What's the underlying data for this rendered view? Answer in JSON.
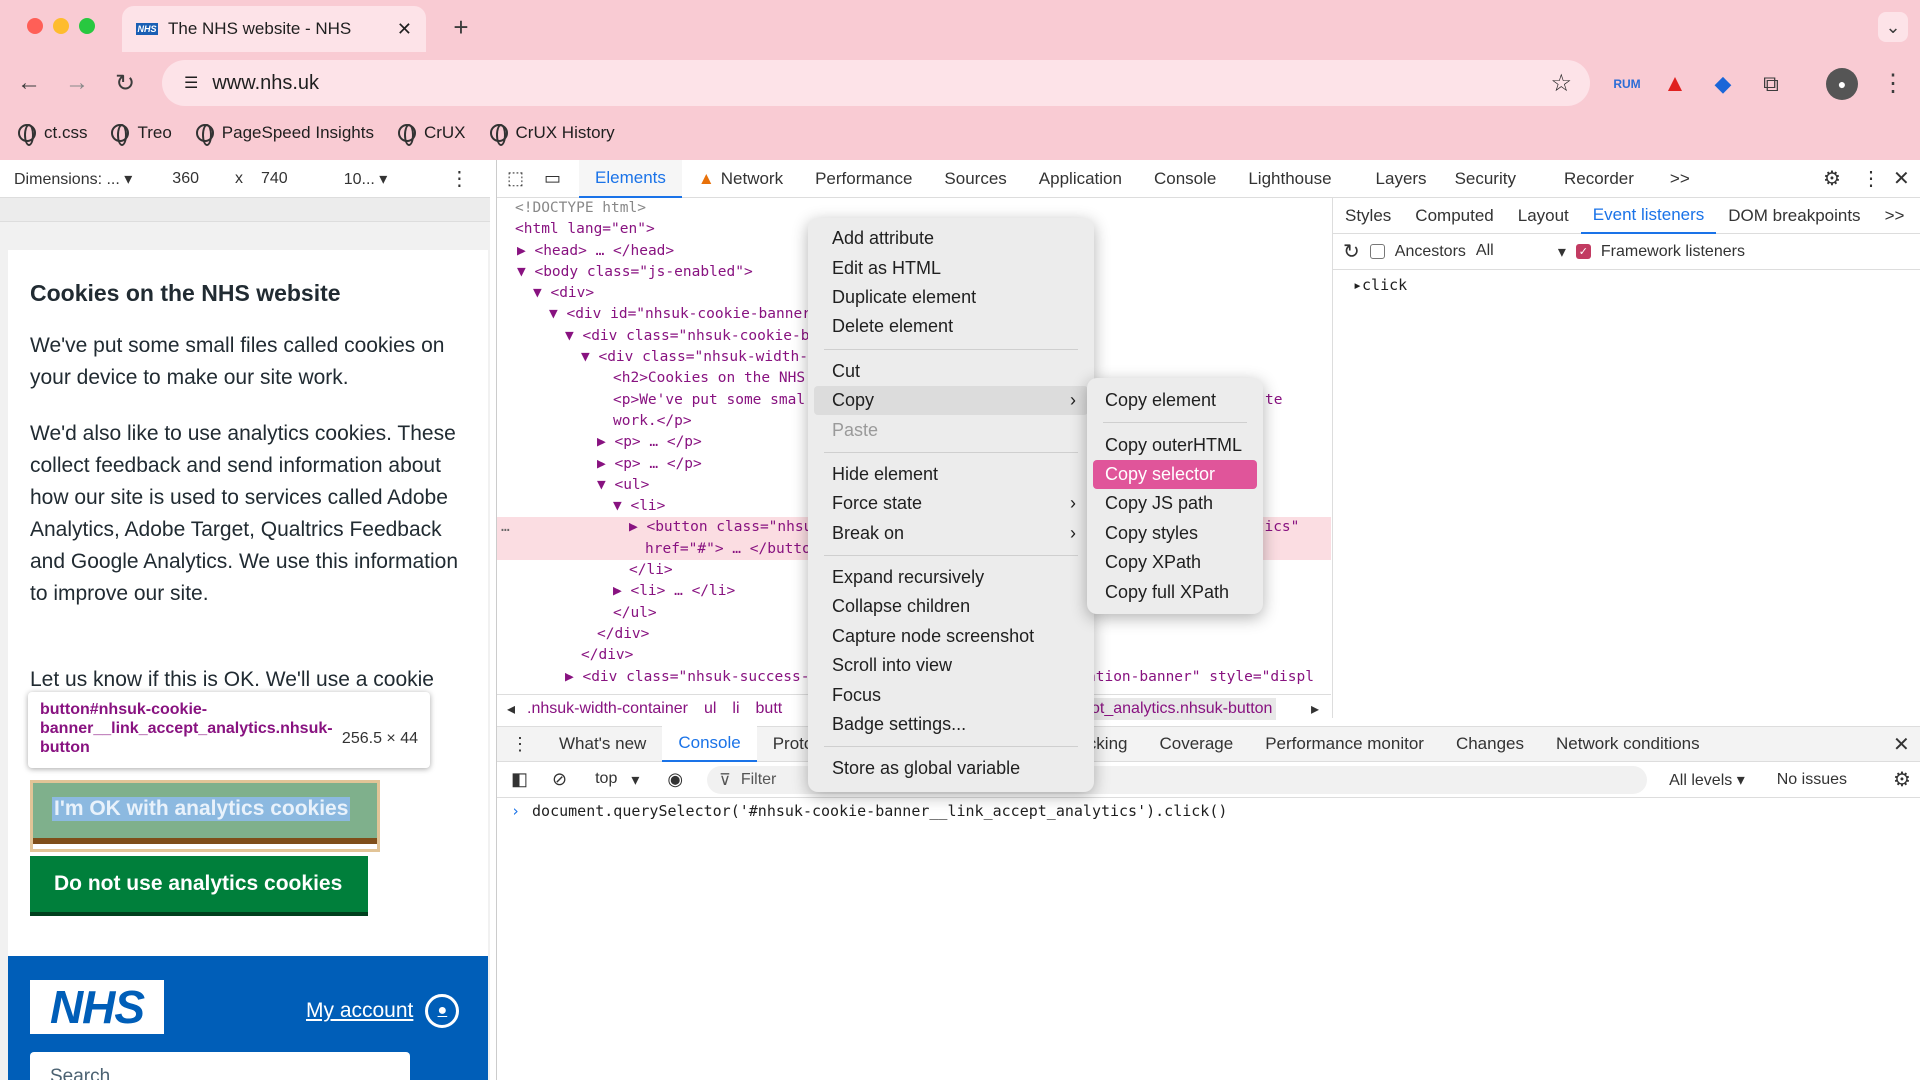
{
  "browser": {
    "tab_title": "The NHS website - NHS",
    "url": "www.nhs.uk",
    "bookmarks": [
      "ct.css",
      "Treo",
      "PageSpeed Insights",
      "CrUX",
      "CrUX History"
    ],
    "extensions": {
      "rum_label": "RUM"
    }
  },
  "device_toolbar": {
    "dimensions_label": "Dimensions: ...",
    "width": "360",
    "times": "x",
    "height": "740",
    "zoom": "10..."
  },
  "page": {
    "heading": "Cookies on the NHS website",
    "para1": "We've put some small files called cookies on your device to make our site work.",
    "para2": "We'd also like to use analytics cookies. These collect feedback and send information about how our site is used to services called Adobe Analytics, Adobe Target, Qualtrics Feedback and Google Analytics. We use this information to improve our site.",
    "para3": "Let us know if this is OK. We'll use a cookie",
    "ok_button": "I'm OK with analytics cookies",
    "no_button": "Do not use analytics cookies",
    "logo": "NHS",
    "my_account": "My account",
    "search_placeholder": "Search"
  },
  "inspect_tooltip": {
    "selector": "button#nhsuk-cookie-banner__link_accept_analytics.nhsuk-button",
    "size": "256.5 × 44"
  },
  "devtools": {
    "tabs": [
      "Elements",
      "Network",
      "Performance",
      "Sources",
      "Application",
      "Console",
      "Lighthouse",
      "Layers",
      "Security",
      "Recorder"
    ],
    "more_tabs": ">>",
    "side_tabs": [
      "Styles",
      "Computed",
      "Layout",
      "Event listeners",
      "DOM breakpoints"
    ],
    "ancestors_label": "Ancestors",
    "ancestors_select": "All",
    "framework_label": "Framework listeners",
    "listener": "click",
    "dom_lines": [
      "<!DOCTYPE html>",
      "<html lang=\"en\">",
      "<head> … </head>",
      "<body class=\"js-enabled\">",
      "<div>",
      "<div id=\"nhsuk-cookie-banner",
      "<div class=\"nhsuk-cookie-b",
      "<div class=\"nhsuk-width-",
      "<h2>Cookies on the NHS",
      "<p>We've put some smal",
      "work.</p>",
      "<p> … </p>",
      "<p> … </p>",
      "<ul>",
      "<li>",
      "<button class=\"nhsu",
      "href=\"#\"> … </butto",
      "</li>",
      "<li> … </li>",
      "</ul>",
      "</div>",
      "</div>",
      "<div class=\"nhsuk-success-"
    ],
    "dom_right_fragments": {
      "line_p": "te",
      "line_button": "ytics\"",
      "line_success": "ation-banner\" style=\"displ"
    },
    "breadcrumbs": [
      ".nhsuk-width-container",
      "ul",
      "li",
      "butt",
      "ot_analytics.nhsuk-button"
    ],
    "drawer_tabs": [
      "What's new",
      "Console",
      "Proto",
      "ork request blocking",
      "Coverage",
      "Performance monitor",
      "Changes",
      "Network conditions"
    ],
    "console_context": "top",
    "filter_placeholder": "Filter",
    "levels": "All levels",
    "issues": "No issues",
    "console_command": "document.querySelector('#nhsuk-cookie-banner__link_accept_analytics').click()"
  },
  "context_menu": {
    "items": [
      "Add attribute",
      "Edit as HTML",
      "Duplicate element",
      "Delete element",
      "Cut",
      "Copy",
      "Paste",
      "Hide element",
      "Force state",
      "Break on",
      "Expand recursively",
      "Collapse children",
      "Capture node screenshot",
      "Scroll into view",
      "Focus",
      "Badge settings...",
      "Store as global variable"
    ]
  },
  "copy_submenu": {
    "items": [
      "Copy element",
      "Copy outerHTML",
      "Copy selector",
      "Copy JS path",
      "Copy styles",
      "Copy XPath",
      "Copy full XPath"
    ],
    "selected": "Copy selector"
  },
  "colors": {
    "chrome_bg": "#f9cbd3",
    "nhs_blue": "#005eb8",
    "nhs_green": "#007f3b",
    "highlight": "#e0559a",
    "devtools_accent": "#1a73e8"
  }
}
